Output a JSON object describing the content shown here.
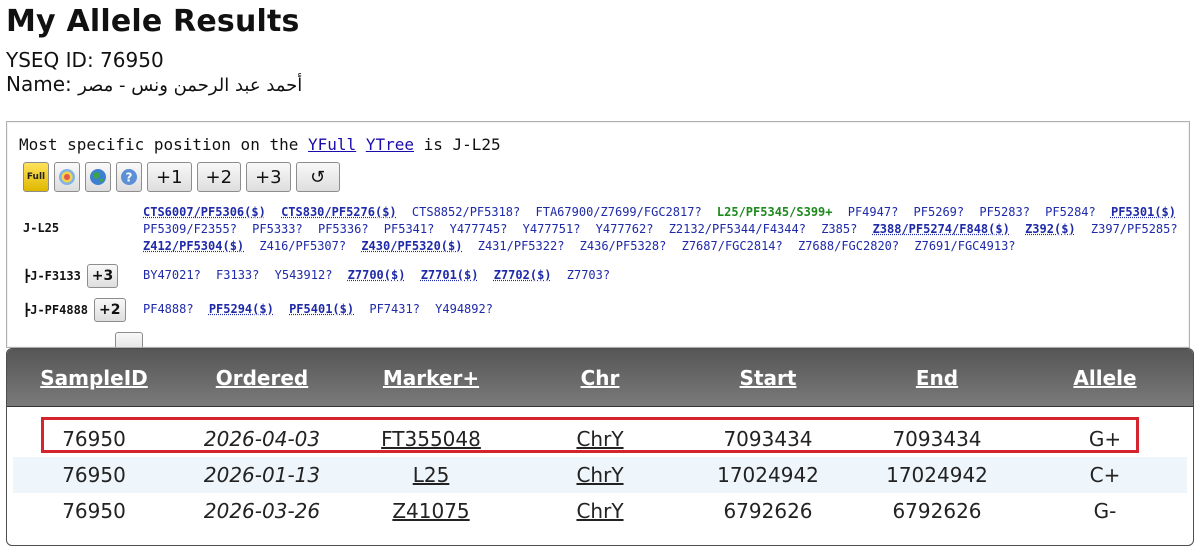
{
  "page": {
    "title": "My Allele Results",
    "yseq_label": "YSEQ ID:",
    "yseq_value": "76950",
    "name_label": "Name:",
    "name_value": "أحمد عبد الرحمن ونس - مصر"
  },
  "tree": {
    "headline_prefix": "Most specific position on the",
    "yfull_link": "YFull",
    "ytree_link": "YTree",
    "headline_suffix": "is J-L25",
    "toolbar": {
      "yfull_icon_label": "Full",
      "btn_plus1": "+1",
      "btn_plus2": "+2",
      "btn_plus3": "+3",
      "btn_reset": "↺"
    },
    "nodes": [
      {
        "label": "J-L25",
        "snps": [
          {
            "t": "CTS6007/PF5306($)",
            "style": "bold"
          },
          {
            "t": "CTS830/PF5276($)",
            "style": "bold"
          },
          {
            "t": "CTS8852/PF5318?",
            "style": ""
          },
          {
            "t": "FTA67900/Z7699/FGC2817?",
            "style": ""
          },
          {
            "t": "L25/PF5345/S399+",
            "style": "pos"
          },
          {
            "t": "PF4947?",
            "style": ""
          },
          {
            "t": "PF5269?",
            "style": ""
          },
          {
            "t": "PF5283?",
            "style": ""
          },
          {
            "t": "PF5284?",
            "style": ""
          },
          {
            "t": "PF5301($)",
            "style": "bold"
          },
          {
            "t": "PF5309/F2355?",
            "style": ""
          },
          {
            "t": "PF5333?",
            "style": ""
          },
          {
            "t": "PF5336?",
            "style": ""
          },
          {
            "t": "PF5341?",
            "style": ""
          },
          {
            "t": "Y477745?",
            "style": ""
          },
          {
            "t": "Y477751?",
            "style": ""
          },
          {
            "t": "Y477762?",
            "style": ""
          },
          {
            "t": "Z2132/PF5344/F4344?",
            "style": ""
          },
          {
            "t": "Z385?",
            "style": ""
          },
          {
            "t": "Z388/PF5274/F848($)",
            "style": "bold"
          },
          {
            "t": "Z392($)",
            "style": "bold"
          },
          {
            "t": "Z397/PF5285?",
            "style": ""
          },
          {
            "t": "Z412/PF5304($)",
            "style": "bold"
          },
          {
            "t": "Z416/PF5307?",
            "style": ""
          },
          {
            "t": "Z430/PF5320($)",
            "style": "bold"
          },
          {
            "t": "Z431/PF5322?",
            "style": ""
          },
          {
            "t": "Z436/PF5328?",
            "style": ""
          },
          {
            "t": "Z7687/FGC2814?",
            "style": ""
          },
          {
            "t": "Z7688/FGC2820?",
            "style": ""
          },
          {
            "t": "Z7691/FGC4913?",
            "style": ""
          }
        ]
      },
      {
        "label": "┣J-F3133",
        "button": "+3",
        "snps": [
          {
            "t": "BY47021?",
            "style": ""
          },
          {
            "t": "F3133?",
            "style": ""
          },
          {
            "t": "Y543912?",
            "style": ""
          },
          {
            "t": "Z7700($)",
            "style": "bold"
          },
          {
            "t": "Z7701($)",
            "style": "bold"
          },
          {
            "t": "Z7702($)",
            "style": "bold"
          },
          {
            "t": "Z7703?",
            "style": ""
          }
        ]
      },
      {
        "label": "┣J-PF4888",
        "button": "+2",
        "snps": [
          {
            "t": "PF4888?",
            "style": ""
          },
          {
            "t": "PF5294($)",
            "style": "bold"
          },
          {
            "t": "PF5401($)",
            "style": "bold"
          },
          {
            "t": "PF7431?",
            "style": ""
          },
          {
            "t": "Y494892?",
            "style": ""
          }
        ]
      }
    ]
  },
  "results": {
    "headers": {
      "sample_id": "SampleID",
      "ordered": "Ordered",
      "marker": "Marker+",
      "chr": "Chr",
      "start": "Start",
      "end": "End",
      "allele": "Allele"
    },
    "rows": [
      {
        "sample_id": "76950",
        "ordered": "2026-04-03",
        "marker": "FT355048",
        "chr": "ChrY",
        "start": "7093434",
        "end": "7093434",
        "allele": "G+"
      },
      {
        "sample_id": "76950",
        "ordered": "2026-01-13",
        "marker": "L25",
        "chr": "ChrY",
        "start": "17024942",
        "end": "17024942",
        "allele": "C+"
      },
      {
        "sample_id": "76950",
        "ordered": "2026-03-26",
        "marker": "Z41075",
        "chr": "ChrY",
        "start": "6792626",
        "end": "6792626",
        "allele": "G-"
      }
    ],
    "highlighted_row": 0,
    "highlight_color": "#d4252f"
  }
}
